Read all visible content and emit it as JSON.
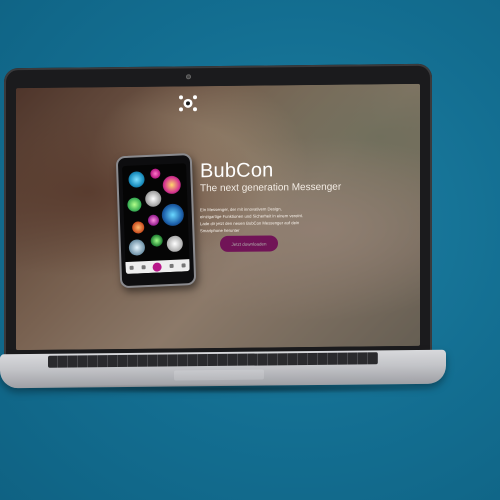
{
  "app": {
    "title": "BubCon",
    "subtitle": "The next generation Messenger",
    "description": "Ein Messenger, der mit innovativem Design, einzigartige Funktionen und Sicherheit in einem vereint. Lade dir jetzt den neuen BubCon Messenger auf dein Smartphone herunter",
    "cta_label": "Jetzt downloaden"
  },
  "colors": {
    "background": "#136e91",
    "accent": "#a0187e"
  },
  "icons": {
    "logo": "bubcon-logo-icon",
    "camera": "camera-icon"
  }
}
